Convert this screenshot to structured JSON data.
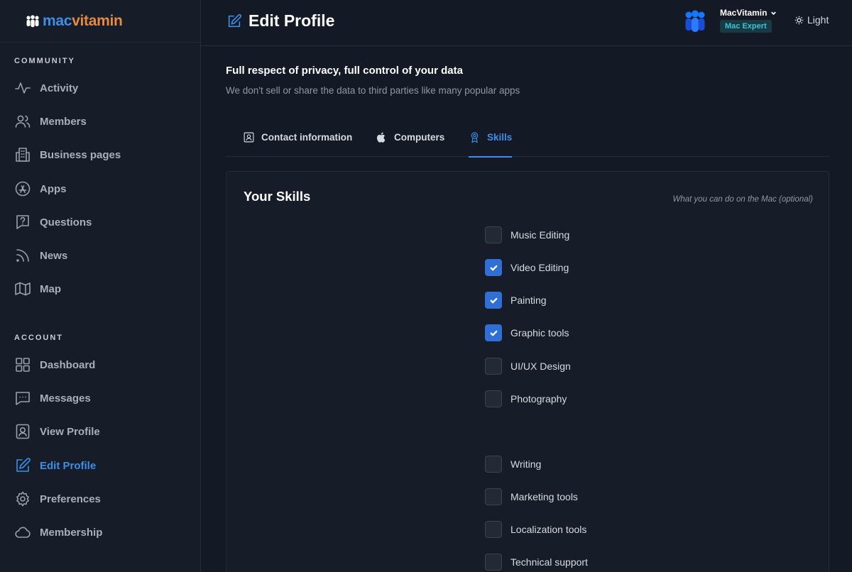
{
  "brand": {
    "part1": "mac",
    "part2": "vitamin"
  },
  "sidebar": {
    "community_title": "COMMUNITY",
    "community": [
      {
        "label": "Activity",
        "icon": "activity-icon"
      },
      {
        "label": "Members",
        "icon": "users-icon"
      },
      {
        "label": "Business pages",
        "icon": "building-icon"
      },
      {
        "label": "Apps",
        "icon": "app-store-icon"
      },
      {
        "label": "Questions",
        "icon": "question-icon"
      },
      {
        "label": "News",
        "icon": "rss-icon"
      },
      {
        "label": "Map",
        "icon": "map-icon"
      }
    ],
    "account_title": "ACCOUNT",
    "account": [
      {
        "label": "Dashboard",
        "icon": "dashboard-icon"
      },
      {
        "label": "Messages",
        "icon": "message-icon"
      },
      {
        "label": "View Profile",
        "icon": "profile-icon"
      },
      {
        "label": "Edit Profile",
        "icon": "edit-icon",
        "active": true
      },
      {
        "label": "Preferences",
        "icon": "gear-icon"
      },
      {
        "label": "Membership",
        "icon": "cloud-icon"
      }
    ]
  },
  "header": {
    "title": "Edit Profile",
    "user_name": "MacVitamin",
    "user_badge": "Mac Expert",
    "theme_label": "Light"
  },
  "intro": {
    "title": "Full respect of privacy, full control of your data",
    "subtitle": "We don't sell or share the data to third parties like many popular apps"
  },
  "tabs": [
    {
      "label": "Contact information",
      "icon": "contact-card-icon"
    },
    {
      "label": "Computers",
      "icon": "apple-icon"
    },
    {
      "label": "Skills",
      "icon": "award-icon",
      "active": true
    }
  ],
  "skills_card": {
    "title": "Your Skills",
    "hint": "What you can do on the Mac (optional)",
    "items": [
      {
        "label": "Music Editing",
        "checked": false
      },
      {
        "label": "Video Editing",
        "checked": true
      },
      {
        "label": "Painting",
        "checked": true
      },
      {
        "label": "Graphic tools",
        "checked": true
      },
      {
        "label": "UI/UX Design",
        "checked": false
      },
      {
        "label": "Photography",
        "checked": false
      },
      {
        "label": "Writing",
        "checked": false
      },
      {
        "label": "Marketing tools",
        "checked": false
      },
      {
        "label": "Localization tools",
        "checked": false
      },
      {
        "label": "Technical support",
        "checked": false
      }
    ]
  },
  "colors": {
    "accent": "#3d8ee8",
    "brand_orange": "#e8893d",
    "badge_text": "#38c3d8",
    "background": "#131a25"
  }
}
